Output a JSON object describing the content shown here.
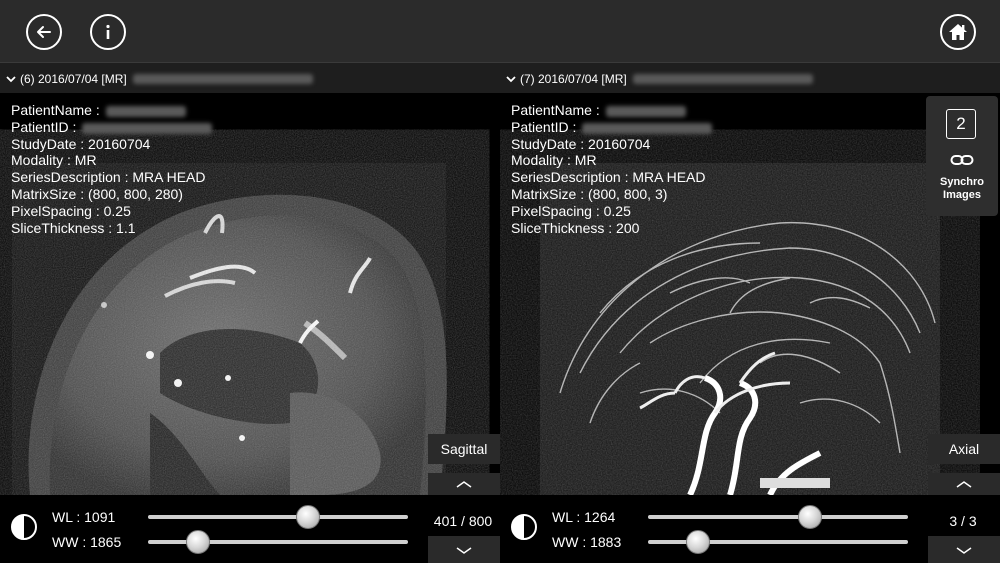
{
  "toolbar": {
    "back_icon": "arrow-left-icon",
    "info_icon": "info-icon",
    "home_icon": "home-icon"
  },
  "panels": [
    {
      "header": "(6) 2016/07/04 [MR]",
      "info": {
        "patient_name_label": "PatientName :",
        "patient_id_label": "PatientID :",
        "study_date": "StudyDate : 20160704",
        "modality": "Modality : MR",
        "series_description": "SeriesDescription : MRA HEAD",
        "matrix_size": "MatrixSize : (800, 800, 280)",
        "pixel_spacing": "PixelSpacing : 0.25",
        "slice_thickness": "SliceThickness : 1.1"
      },
      "orientation": "Sagittal",
      "wl": "WL : 1091",
      "ww": "WW : 1865",
      "wl_level": 0.61,
      "ww_level": 0.19,
      "slice_counter": "401 / 800"
    },
    {
      "header": "(7) 2016/07/04 [MR]",
      "info": {
        "patient_name_label": "PatientName :",
        "patient_id_label": "PatientID :",
        "study_date": "StudyDate : 20160704",
        "modality": "Modality : MR",
        "series_description": "SeriesDescription : MRA HEAD",
        "matrix_size": "MatrixSize : (800, 800, 3)",
        "pixel_spacing": "PixelSpacing : 0.25",
        "slice_thickness": "SliceThickness : 200"
      },
      "orientation": "Axial",
      "wl": "WL : 1264",
      "ww": "WW : 1883",
      "wl_level": 0.62,
      "ww_level": 0.19,
      "slice_counter": "3 / 3",
      "synchro": {
        "count": "2",
        "label_line1": "Synchro",
        "label_line2": "Images",
        "icon": "link-icon"
      }
    }
  ]
}
